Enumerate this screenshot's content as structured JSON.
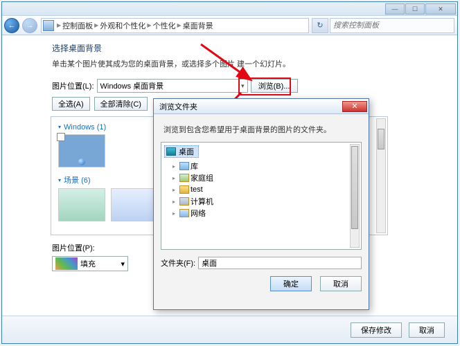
{
  "window": {
    "breadcrumb": [
      "控制面板",
      "外观和个性化",
      "个性化",
      "桌面背景"
    ],
    "search_placeholder": "搜索控制面板"
  },
  "page": {
    "title": "选择桌面背景",
    "desc": "单击某个图片使其成为您的桌面背景，或选择多个图片 建一个幻灯片。"
  },
  "location": {
    "label": "图片位置(L):",
    "value": "Windows 桌面背景",
    "browse": "浏览(B)..."
  },
  "sel_buttons": {
    "select_all": "全选(A)",
    "clear_all": "全部清除(C)"
  },
  "gallery": {
    "groups": [
      {
        "name": "Windows (1)"
      },
      {
        "name": "场景 (6)"
      }
    ]
  },
  "position": {
    "label": "图片位置(P):",
    "fill": "填充"
  },
  "footer": {
    "save": "保存修改",
    "cancel": "取消"
  },
  "dialog": {
    "title": "浏览文件夹",
    "hint": "浏览到包含您希望用于桌面背景的图片的文件夹。",
    "selected": "桌面",
    "tree": [
      "库",
      "家庭组",
      "test",
      "计算机",
      "网络"
    ],
    "folder_label": "文件夹(F):",
    "folder_value": "桌面",
    "ok": "确定",
    "cancel": "取消"
  },
  "icons": {
    "back": "←",
    "fwd": "→",
    "close": "✕",
    "min": "—",
    "max": "☐",
    "refresh": "↻",
    "down": "▾"
  }
}
